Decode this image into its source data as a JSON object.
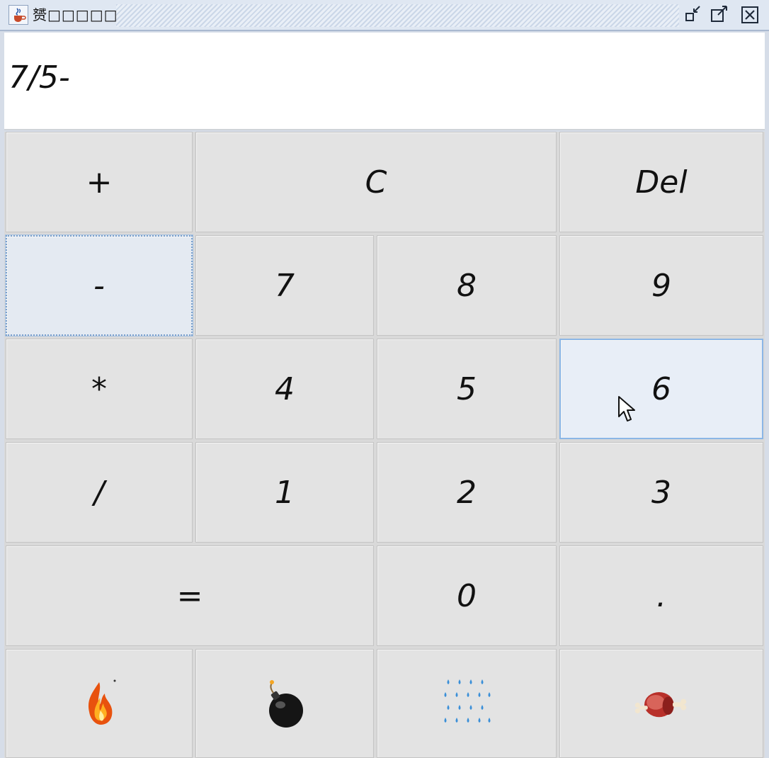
{
  "window": {
    "title": "赟□□□□□",
    "icons": [
      "java-cup-icon",
      "minimize-icon",
      "maximize-icon",
      "close-icon"
    ]
  },
  "display": {
    "value": "7/5-"
  },
  "buttons": {
    "plus": "+",
    "clear": "C",
    "del": "Del",
    "minus": "-",
    "seven": "7",
    "eight": "8",
    "nine": "9",
    "times": "*",
    "four": "4",
    "five": "5",
    "six": "6",
    "divide": "/",
    "one": "1",
    "two": "2",
    "three": "3",
    "equals": "=",
    "zero": "0",
    "dot": "."
  },
  "emoji_buttons": [
    "fire-icon",
    "bomb-icon",
    "rain-icon",
    "meat-icon"
  ],
  "state": {
    "focused_button": "-",
    "hovered_button": "6"
  },
  "colors": {
    "button_bg": "#e3e3e3",
    "focus_border": "#7aa0cc",
    "hover_bg": "#e8eef7"
  }
}
